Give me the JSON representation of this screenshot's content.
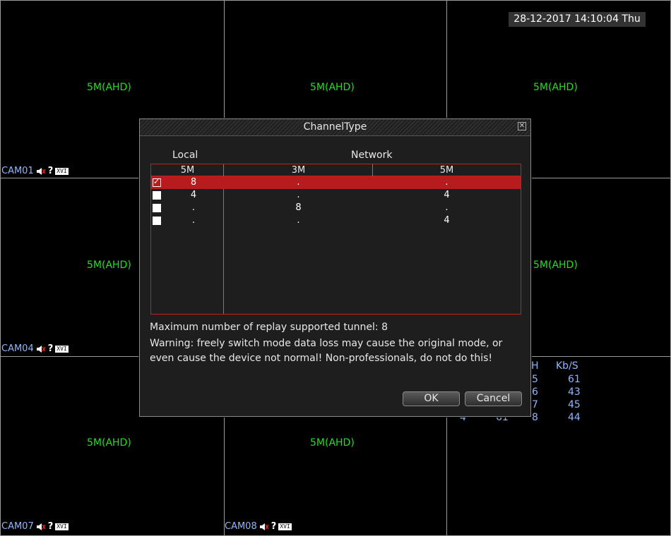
{
  "datetime": "28-12-2017 14:10:04 Thu",
  "cells": [
    {
      "resolution": "5M(AHD)",
      "cam": "CAM01"
    },
    {
      "resolution": "5M(AHD)",
      "cam": ""
    },
    {
      "resolution": "5M(AHD)",
      "cam": ""
    },
    {
      "resolution": "5M(AHD)",
      "cam": ""
    },
    {
      "resolution": "",
      "cam": ""
    },
    {
      "resolution": "5M(AHD)",
      "cam": ""
    },
    {
      "resolution": "5M(AHD)",
      "cam": "CAM07"
    },
    {
      "resolution": "5M(AHD)",
      "cam": "CAM08"
    },
    {
      "resolution": "",
      "cam": ""
    }
  ],
  "cam04": "CAM04",
  "cam04_res": "5M(AHD)",
  "badge": "XVI",
  "stats": {
    "col_h": "H",
    "col_kbs": "Kb/S",
    "rows": [
      {
        "ch": "",
        "h": "5",
        "kbs": "61"
      },
      {
        "ch": "",
        "h": "6",
        "kbs": "43"
      },
      {
        "ch": "",
        "h": "7",
        "kbs": "45"
      },
      {
        "ch": "4",
        "mid": "61",
        "h": "8",
        "kbs": "44"
      }
    ]
  },
  "dialog": {
    "title": "ChannelType",
    "local_label": "Local",
    "network_label": "Network",
    "columns": [
      "5M",
      "3M",
      "5M"
    ],
    "rows": [
      {
        "checked": true,
        "local": "8",
        "net3m": ".",
        "net5m": "."
      },
      {
        "checked": false,
        "local": "4",
        "net3m": ".",
        "net5m": "4"
      },
      {
        "checked": false,
        "local": ".",
        "net3m": "8",
        "net5m": "."
      },
      {
        "checked": false,
        "local": ".",
        "net3m": ".",
        "net5m": "4"
      }
    ],
    "max_replay": "Maximum number of replay supported tunnel: 8",
    "warning_line1": "Warning: freely switch mode data loss may cause the original mode, or",
    "warning_line2": "even cause the device not normal! Non-professionals, do not do this!",
    "ok_label": "OK",
    "cancel_label": "Cancel"
  }
}
